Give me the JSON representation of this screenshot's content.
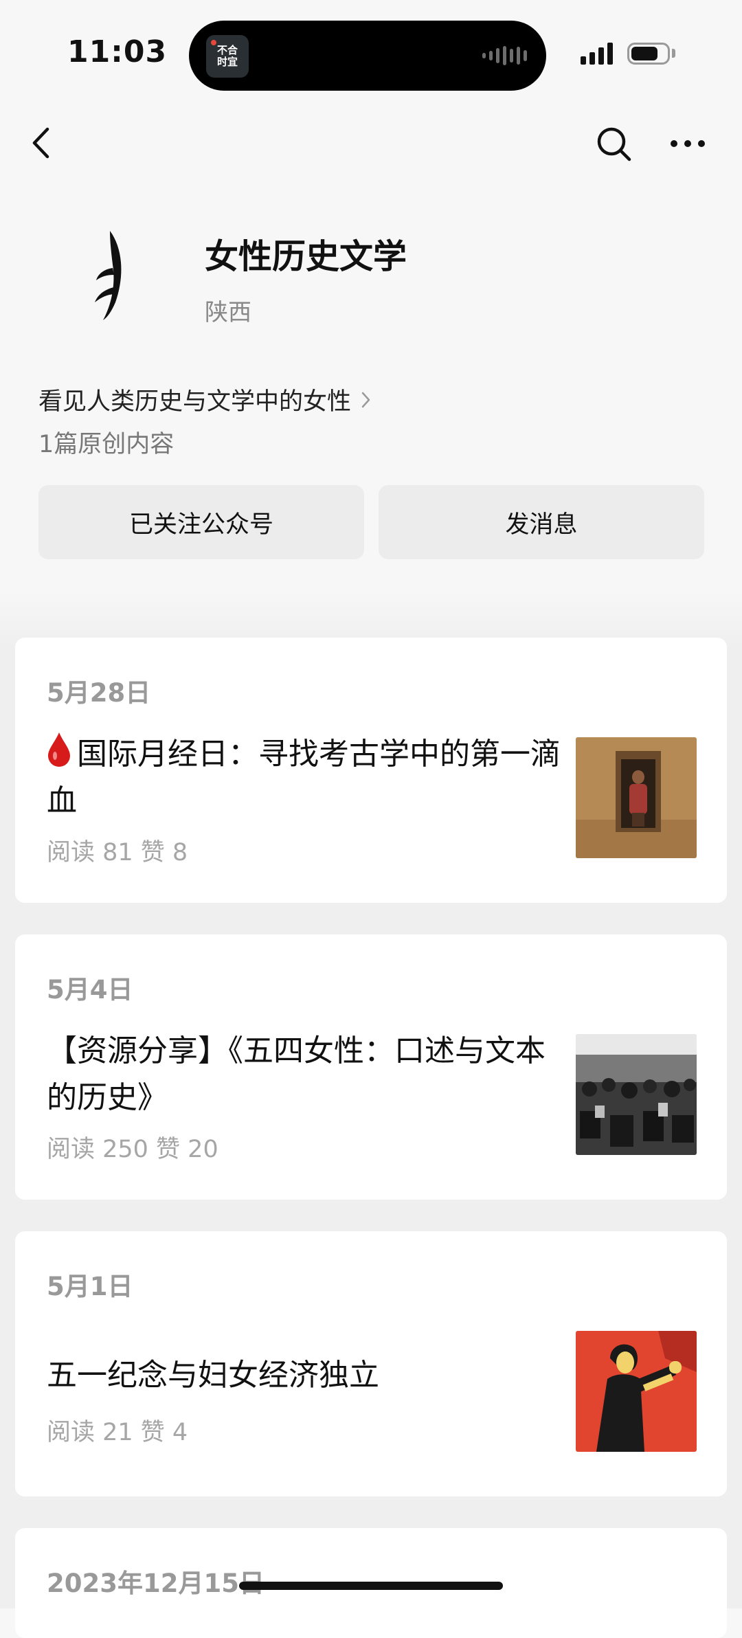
{
  "status_bar": {
    "time": "11:03",
    "island_app_label_line1": "不合",
    "island_app_label_line2": "时宜"
  },
  "profile": {
    "name": "女性历史文学",
    "location": "陕西",
    "intro": "看见人类历史与文学中的女性",
    "original_count": "1篇原创内容"
  },
  "buttons": {
    "follow": "已关注公众号",
    "message": "发消息"
  },
  "articles": [
    {
      "date": "5月28日",
      "title": "国际月经日：寻找考古学中的第一滴血",
      "title_prefix_icon": "blood-drop-icon",
      "stats": "阅读 81  赞 8"
    },
    {
      "date": "5月4日",
      "title": "【资源分享】《五四女性：口述与文本的历史》",
      "stats": "阅读 250  赞 20"
    },
    {
      "date": "5月1日",
      "title": "五一纪念与妇女经济独立",
      "stats": "阅读 21  赞 4"
    },
    {
      "date": "2023年12月15日"
    }
  ],
  "colors": {
    "accent_red": "#d71a1a",
    "poster_red": "#e2452f",
    "page_bg": "#efefef"
  }
}
